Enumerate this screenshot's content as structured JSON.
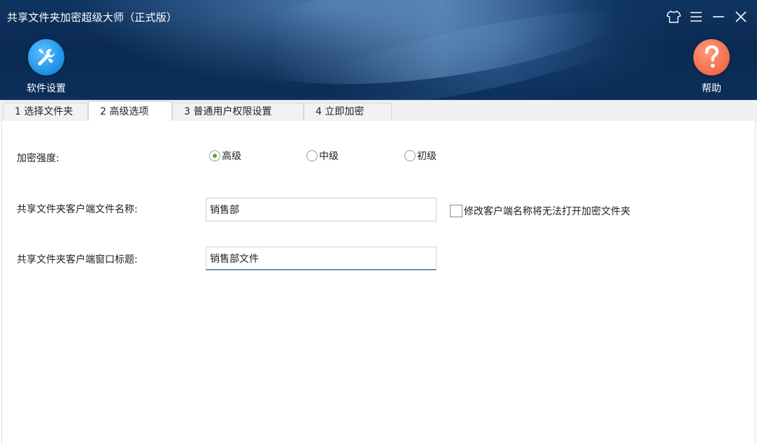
{
  "app": {
    "title": "共享文件夹加密超级大师（正式版）"
  },
  "title_bar": {
    "icons": [
      "skin-icon",
      "menu-icon",
      "minimize-icon",
      "close-icon"
    ]
  },
  "toolbar": {
    "settings_label": "软件设置",
    "help_label": "帮助"
  },
  "tabs": [
    {
      "label": "1 选择文件夹",
      "active": false
    },
    {
      "label": "2 高级选项",
      "active": true
    },
    {
      "label": "3 普通用户权限设置",
      "active": false
    },
    {
      "label": "4 立即加密",
      "active": false
    }
  ],
  "advanced": {
    "strength_label": "加密强度:",
    "strength_options": [
      {
        "label": "高级",
        "checked": true
      },
      {
        "label": "中级",
        "checked": false
      },
      {
        "label": "初级",
        "checked": false
      }
    ],
    "client_name_label": "共享文件夹客户端文件名称:",
    "client_name_value": "销售部",
    "rename_warning_checkbox": {
      "label": "修改客户端名称将无法打开加密文件夹",
      "checked": false
    },
    "window_title_label": "共享文件夹客户端窗口标题:",
    "window_title_value": "销售部文件"
  },
  "colors": {
    "header_bg": "#0b2f5a",
    "settings_icon_bg": "#1b8ee6",
    "help_icon_bg": "#f26b4c",
    "radio_checked": "#5aa63a"
  }
}
